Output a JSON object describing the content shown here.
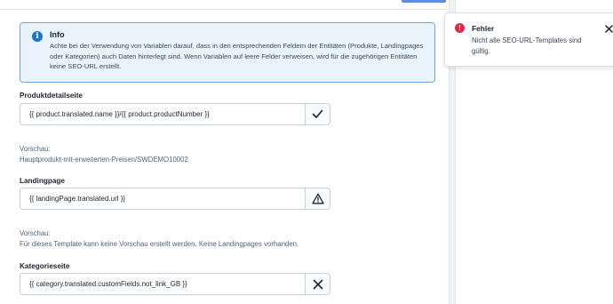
{
  "info": {
    "title": "Info",
    "text": "Achte bei der Verwendung von Variablen darauf, dass in den entsprechenden Feldern der Entitäten (Produkte, Landingpages oder Kategorien) auch Daten hinterlegt sind. Wenn Variablen auf leere Felder verweisen, wird für die zugehörigen Entitäten keine SEO-URL erstellt.",
    "icon": "info-circle-icon",
    "accent": "#1d75d3"
  },
  "fields": [
    {
      "label": "Produktdetailseite",
      "value": "{{ product.translated.name }}/{{ product.productNumber }}",
      "status_icon": "checkmark-icon",
      "preview_label": "Vorschau:",
      "preview_value": "Hauptprodukt-mit-erweiterten-Preisen/SWDEMO10002"
    },
    {
      "label": "Landingpage",
      "value": "{{ landingPage.translated.url }}",
      "status_icon": "warning-icon",
      "preview_label": "Vorschau:",
      "preview_value": "Für dieses Template kann keine Vorschau erstellt werden. Keine Landingpages vorhanden."
    },
    {
      "label": "Kategorieseite",
      "value": "{{ category.translated.customFields.not_link_GB }}",
      "status_icon": "error-x-icon"
    }
  ],
  "toast": {
    "title": "Fehler",
    "message": "Nicht alle SEO-URL-Templates sind gültig.",
    "icon": "error-circle-icon",
    "icon_color": "#de294c"
  }
}
